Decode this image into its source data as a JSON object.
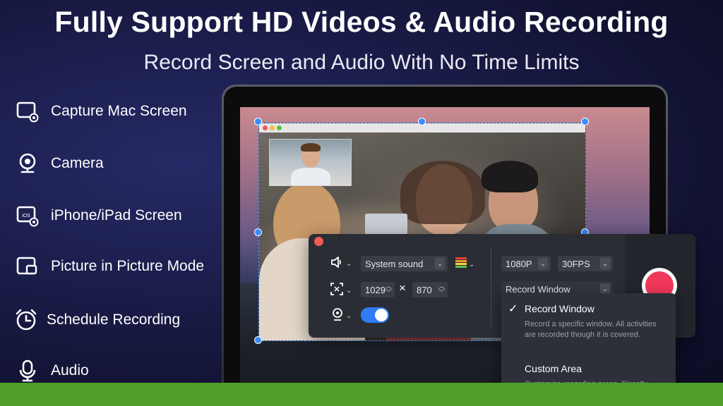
{
  "headline": "Fully Support HD Videos & Audio Recording",
  "subline": "Record Screen and Audio With No Time Limits",
  "features": [
    {
      "label": "Capture Mac Screen",
      "icon": "screen-capture-icon"
    },
    {
      "label": "Camera",
      "icon": "webcam-icon"
    },
    {
      "label": "iPhone/iPad Screen",
      "icon": "ios-screen-icon",
      "icon_text": "iOS"
    },
    {
      "label": "Picture in Picture Mode",
      "icon": "picture-in-picture-icon"
    },
    {
      "label": "Schedule Recording",
      "icon": "alarm-clock-icon"
    },
    {
      "label": "Audio",
      "icon": "microphone-icon"
    }
  ],
  "panel": {
    "sound_source": "System sound",
    "width": "1029",
    "times": "×",
    "height": "870",
    "resolution": "1080P",
    "fps": "30FPS",
    "mode": "Record Window",
    "webcam_toggle_on": true
  },
  "dropdown": {
    "item1_title": "Record Window",
    "item1_desc": "Record a specific window. All activities are recorded though it is covered.",
    "item2_title": "Custom Area",
    "item2_desc": "Customize recording areas. Directly"
  },
  "colors": {
    "accent_blue": "#2f7cf6",
    "record_red": "#f1385a",
    "bottom_bar_green": "#4f9e27"
  }
}
